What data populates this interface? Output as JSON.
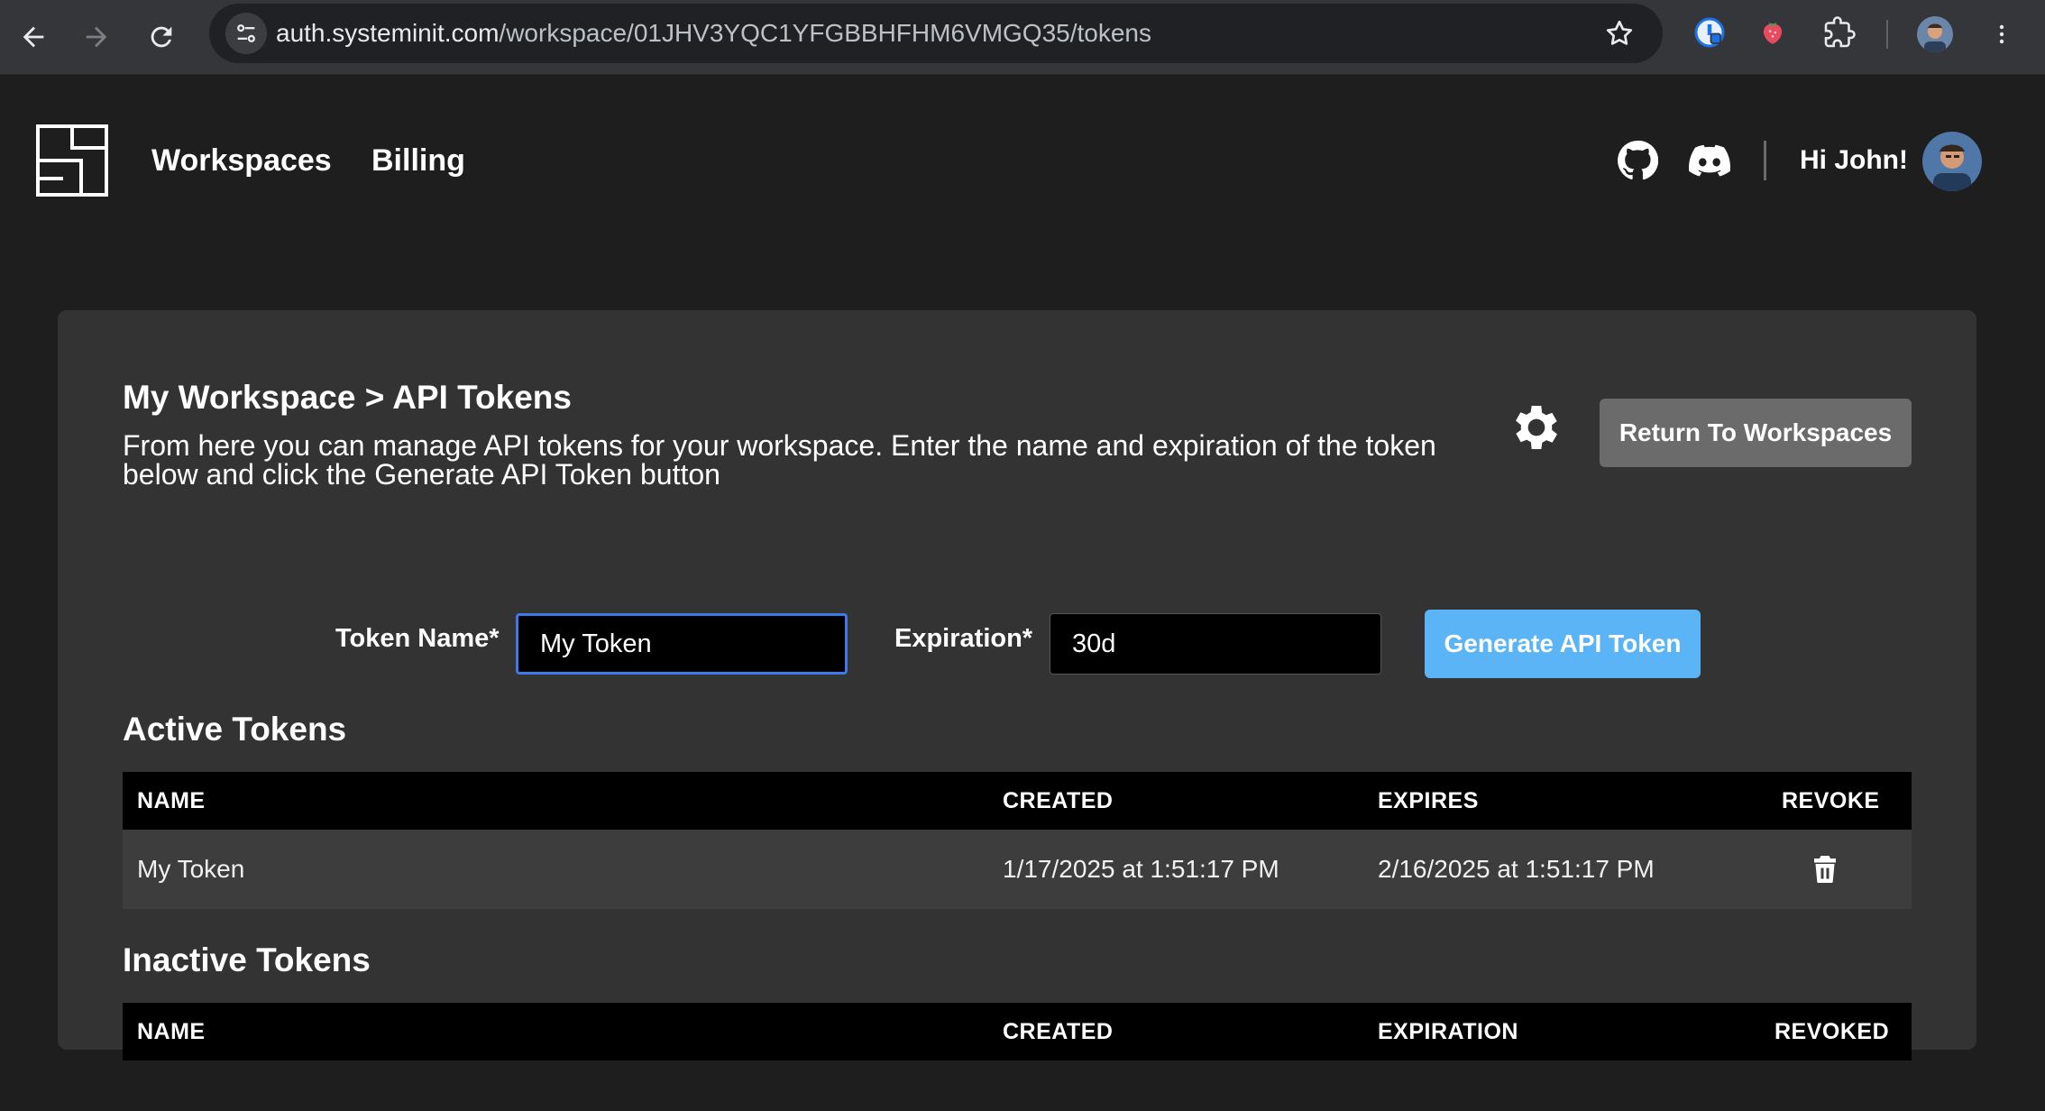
{
  "browser": {
    "url_host": "auth.systeminit.com",
    "url_path": "/workspace/01JHV3YQC1YFGBBHFHM6VMGQ35/tokens",
    "icons": [
      "back-arrow-icon",
      "forward-arrow-icon",
      "reload-icon",
      "site-settings-icon",
      "star-icon",
      "password-manager-icon",
      "extension-icon",
      "puzzle-icon",
      "profile-avatar",
      "kebab-menu-icon"
    ]
  },
  "header": {
    "nav": {
      "workspaces": "Workspaces",
      "billing": "Billing"
    },
    "greeting": "Hi John!"
  },
  "page": {
    "title": "My Workspace > API Tokens",
    "description": "From here you can manage API tokens for your workspace. Enter the name and expiration of the token below and click the Generate API Token button",
    "return_button": "Return To Workspaces"
  },
  "form": {
    "token_name_label": "Token Name*",
    "token_name_value": "My Token",
    "expiration_label": "Expiration*",
    "expiration_value": "30d",
    "generate_button": "Generate API Token"
  },
  "active_tokens": {
    "title": "Active Tokens",
    "columns": [
      "NAME",
      "CREATED",
      "EXPIRES",
      "REVOKE"
    ],
    "rows": [
      {
        "name": "My Token",
        "created": "1/17/2025 at 1:51:17 PM",
        "expires": "2/16/2025 at 1:51:17 PM"
      }
    ]
  },
  "inactive_tokens": {
    "title": "Inactive Tokens",
    "columns": [
      "NAME",
      "CREATED",
      "EXPIRATION",
      "REVOKED"
    ],
    "rows": []
  },
  "colors": {
    "app_background": "#1e1e1e",
    "card_background": "#333333",
    "primary_button": "#5ab4f5",
    "secondary_button": "#6b6b6b",
    "focus_ring": "#3b7ae8",
    "table_header": "#000000"
  }
}
